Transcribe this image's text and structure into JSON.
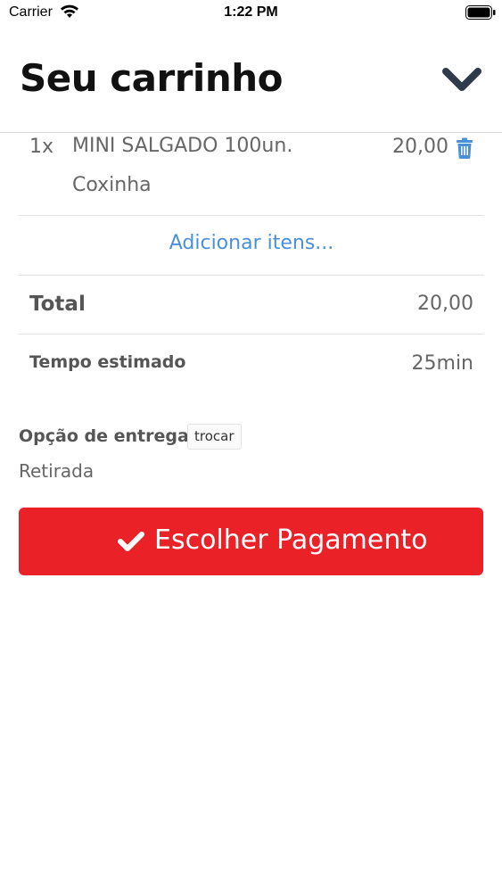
{
  "status_bar": {
    "carrier": "Carrier",
    "time": "1:22 PM"
  },
  "header": {
    "title": "Seu carrinho",
    "collapse_icon": "chevron-down-icon"
  },
  "cart": {
    "items": [
      {
        "quantity": "1x",
        "name": "MINI SALGADO 100un.",
        "variant": "Coxinha",
        "price": "20,00",
        "delete_icon": "trash-icon"
      }
    ],
    "add_items_label": "Adicionar itens...",
    "total_label": "Total",
    "total_value": "20,00",
    "estimated_time_label": "Tempo estimado",
    "estimated_time_value": "25min"
  },
  "delivery": {
    "label": "Opção de entrega",
    "swap_label": "trocar",
    "value": "Retirada"
  },
  "checkout": {
    "label": "Escolher Pagamento",
    "icon": "check-icon"
  },
  "colors": {
    "accent_red": "#ea2227",
    "link_blue": "#4a90d9",
    "chevron_dark": "#2f3a4a"
  }
}
